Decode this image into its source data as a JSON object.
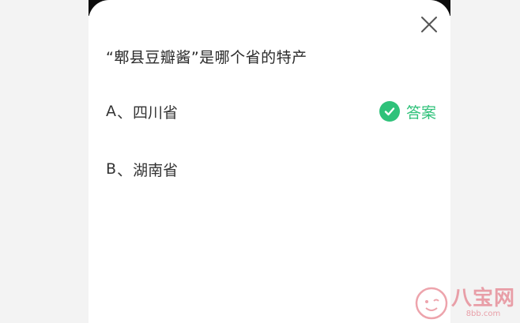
{
  "question": {
    "text": "“郫县豆瓣酱”是哪个省的特产"
  },
  "options": [
    {
      "letter": "A",
      "separator": "、",
      "text": "四川省",
      "is_answer": true
    },
    {
      "letter": "B",
      "separator": "、",
      "text": "湖南省",
      "is_answer": false
    }
  ],
  "answer_label": "答案",
  "icons": {
    "close": "close-icon",
    "check": "check-circle-icon"
  },
  "colors": {
    "accent_green": "#2fc27a",
    "text_dark": "#2a2a2a",
    "backdrop": "#f3f3f3",
    "watermark": "#e05a6a"
  },
  "watermark": {
    "title": "八宝网",
    "url": "8bb.com"
  }
}
